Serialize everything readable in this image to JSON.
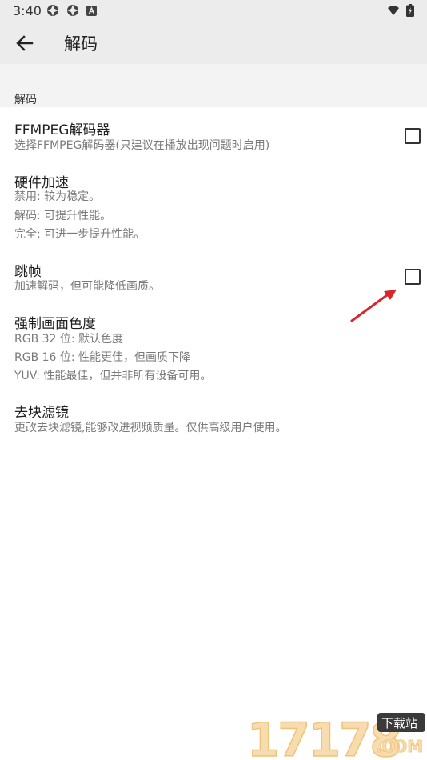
{
  "status_bar": {
    "time": "3:40"
  },
  "header": {
    "title": "解码"
  },
  "category": {
    "label": "解码"
  },
  "settings": [
    {
      "title": "FFMPEG解码器",
      "lines": [
        "选择FFMPEG解码器(只建议在播放出现问题时启用)"
      ],
      "checkbox": true,
      "checked": false
    },
    {
      "title": "硬件加速",
      "lines": [
        "禁用: 较为稳定。",
        "解码: 可提升性能。",
        "完全: 可进一步提升性能。"
      ],
      "checkbox": false
    },
    {
      "title": "跳帧",
      "lines": [
        "加速解码，但可能降低画质。"
      ],
      "checkbox": true,
      "checked": false
    },
    {
      "title": "强制画面色度",
      "lines": [
        "RGB 32 位: 默认色度",
        "RGB 16 位: 性能更佳，但画质下降",
        "YUV: 性能最佳，但并非所有设备可用。"
      ],
      "checkbox": false
    },
    {
      "title": "去块滤镜",
      "lines": [
        "更改去块滤镜,能够改进视频质量。仅供高级用户使用。"
      ],
      "checkbox": false
    }
  ],
  "watermark": {
    "text": "17178",
    "badge": "下载站",
    "domain": ".COM"
  }
}
